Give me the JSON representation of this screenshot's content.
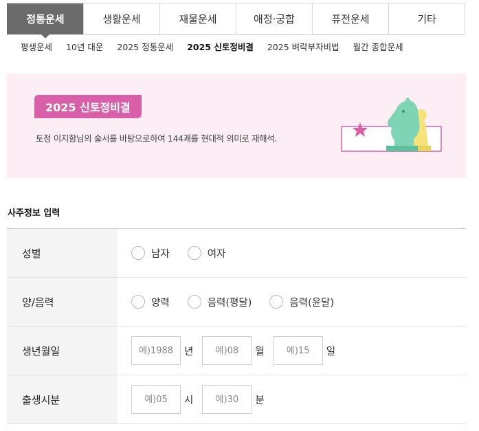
{
  "top_tabs": [
    {
      "label": "정통운세",
      "active": true
    },
    {
      "label": "생활운세",
      "active": false
    },
    {
      "label": "재물운세",
      "active": false
    },
    {
      "label": "애정·궁합",
      "active": false
    },
    {
      "label": "퓨전운세",
      "active": false
    },
    {
      "label": "기타",
      "active": false
    }
  ],
  "sub_tabs": [
    {
      "label": "평생운세",
      "active": false
    },
    {
      "label": "10년 대운",
      "active": false
    },
    {
      "label": "2025 정통운세",
      "active": false
    },
    {
      "label": "2025 신토정비결",
      "active": true
    },
    {
      "label": "2025 벼락부자비법",
      "active": false
    },
    {
      "label": "월간 종합운세",
      "active": false
    }
  ],
  "banner": {
    "title": "2025 신토정비결",
    "description": "토정 이지함님의 술서를 바탕으로하여 144괘를 현대적 의미로 재해석.",
    "art_icon": "chess-knight-pawn-icon",
    "colors": {
      "background": "#fdeef6",
      "badge": "#d960a8",
      "knight": "#7fd4b6",
      "pawn": "#f5e37a"
    }
  },
  "form": {
    "section_title": "사주정보 입력",
    "gender": {
      "label": "성별",
      "options": [
        "남자",
        "여자"
      ]
    },
    "calendar": {
      "label": "양/음력",
      "options": [
        "양력",
        "음력(평달)",
        "음력(윤달)"
      ]
    },
    "birthdate": {
      "label": "생년월일",
      "year_placeholder": "예)1988",
      "year_unit": "년",
      "month_placeholder": "예)08",
      "month_unit": "월",
      "day_placeholder": "예)15",
      "day_unit": "일"
    },
    "birthtime": {
      "label": "출생시분",
      "hour_placeholder": "예)05",
      "hour_unit": "시",
      "minute_placeholder": "예)30",
      "minute_unit": "분"
    }
  }
}
